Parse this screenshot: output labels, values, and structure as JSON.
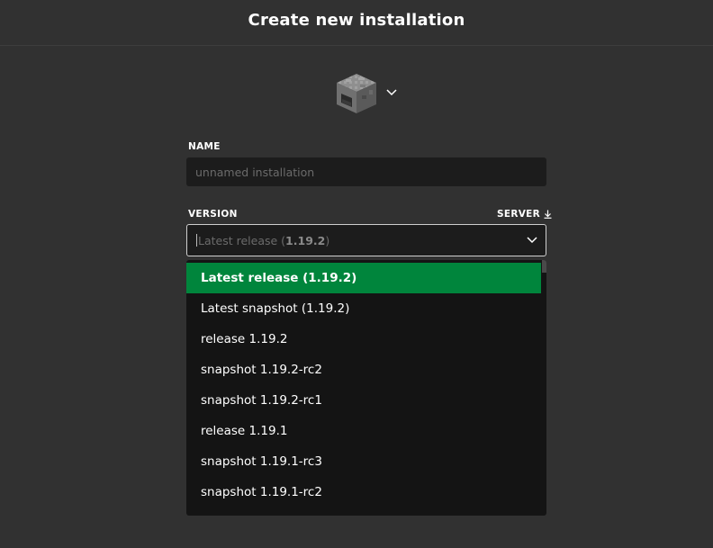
{
  "header": {
    "title": "Create new installation"
  },
  "icon_picker": {
    "icon": "furnace-block-icon",
    "chevron": "chevron-down-icon"
  },
  "name_field": {
    "label": "NAME",
    "placeholder": "unnamed installation",
    "value": ""
  },
  "version_field": {
    "label": "VERSION",
    "server_label": "SERVER",
    "server_icon": "download-icon",
    "placeholder_prefix": "Latest release (",
    "placeholder_version": "1.19.2",
    "placeholder_suffix": ")"
  },
  "dropdown": {
    "items": [
      {
        "label": "Latest release (1.19.2)",
        "selected": true
      },
      {
        "label": "Latest snapshot (1.19.2)",
        "selected": false
      },
      {
        "label": "release 1.19.2",
        "selected": false
      },
      {
        "label": "snapshot 1.19.2-rc2",
        "selected": false
      },
      {
        "label": "snapshot 1.19.2-rc1",
        "selected": false
      },
      {
        "label": "release 1.19.1",
        "selected": false
      },
      {
        "label": "snapshot 1.19.1-rc3",
        "selected": false
      },
      {
        "label": "snapshot 1.19.1-rc2",
        "selected": false
      }
    ]
  },
  "colors": {
    "background": "#313131",
    "input_bg": "#1c1c1c",
    "dropdown_bg": "#141414",
    "selected_bg": "#00853c",
    "placeholder": "#6b6b6b"
  }
}
